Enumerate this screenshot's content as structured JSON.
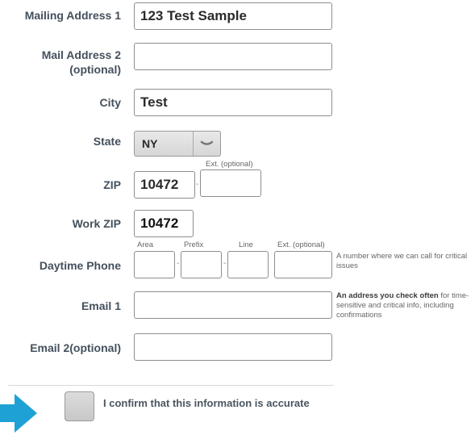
{
  "fields": {
    "mailing_address_1": {
      "label": "Mailing Address 1",
      "value": "123 Test Sample"
    },
    "mail_address_2": {
      "label_line1": "Mail Address 2",
      "label_line2": "(optional)",
      "value": ""
    },
    "city": {
      "label": "City",
      "value": "Test"
    },
    "state": {
      "label": "State",
      "value": "NY"
    },
    "zip": {
      "label": "ZIP",
      "value": "10472",
      "ext_label": "Ext. (optional)",
      "ext_value": ""
    },
    "work_zip": {
      "label": "Work ZIP",
      "value": "10472"
    },
    "daytime_phone": {
      "label": "Daytime Phone",
      "area_label": "Area",
      "prefix_label": "Prefix",
      "line_label": "Line",
      "ext_label": "Ext. (optional)",
      "note": "A number where we can call for critical issues"
    },
    "email_1": {
      "label": "Email 1",
      "note_bold": "An address you check often",
      "note_rest": " for time-sensitive and critical info, including confirmations"
    },
    "email_2": {
      "label": "Email 2(optional)"
    }
  },
  "separator": "-",
  "confirm": {
    "label": "I confirm that this information is accurate",
    "checked": false
  },
  "colors": {
    "arrow": "#1ea2d6",
    "label": "#44505c"
  },
  "icons": {
    "state_dropdown": "chevron-down-icon",
    "pointer": "arrow-right-icon"
  }
}
